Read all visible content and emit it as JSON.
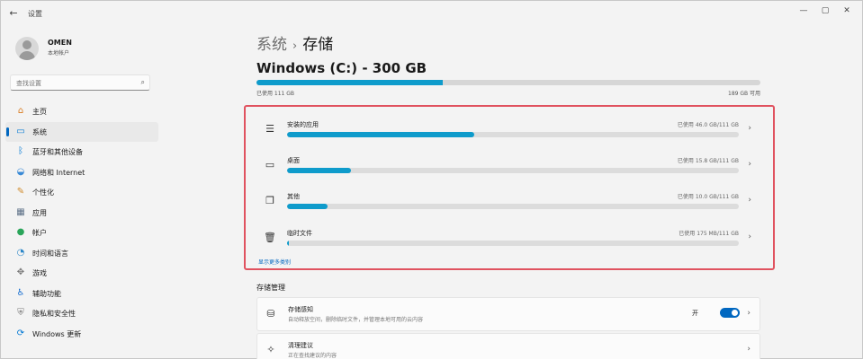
{
  "window": {
    "back_glyph": "←",
    "title": "设置",
    "minimize_glyph": "—",
    "maximize_glyph": "▢",
    "close_glyph": "✕"
  },
  "user": {
    "name": "OMEN",
    "account_type": "本地帐户"
  },
  "search": {
    "placeholder": "查找设置",
    "icon": "search-icon",
    "glyph": "⌕"
  },
  "nav": [
    {
      "label": "主页",
      "icon": "home-icon",
      "glyph": "⌂",
      "color": "#d97a1e",
      "active": false
    },
    {
      "label": "系统",
      "icon": "system-icon",
      "glyph": "▭",
      "color": "#0078d4",
      "active": true
    },
    {
      "label": "蓝牙和其他设备",
      "icon": "bluetooth-icon",
      "glyph": "ᛒ",
      "color": "#0078d4",
      "active": false
    },
    {
      "label": "网络和 Internet",
      "icon": "wifi-icon",
      "glyph": "◒",
      "color": "#3a8ad6",
      "active": false
    },
    {
      "label": "个性化",
      "icon": "brush-icon",
      "glyph": "✎",
      "color": "#d08a2a",
      "active": false
    },
    {
      "label": "应用",
      "icon": "apps-icon",
      "glyph": "▦",
      "color": "#5b6f86",
      "active": false
    },
    {
      "label": "帐户",
      "icon": "account-icon",
      "glyph": "●",
      "color": "#2aa55a",
      "active": false
    },
    {
      "label": "时间和语言",
      "icon": "globe-clock-icon",
      "glyph": "◔",
      "color": "#2a86c8",
      "active": false
    },
    {
      "label": "游戏",
      "icon": "gamepad-icon",
      "glyph": "✥",
      "color": "#777777",
      "active": false
    },
    {
      "label": "辅助功能",
      "icon": "accessibility-icon",
      "glyph": "♿",
      "color": "#1a6fd0",
      "active": false
    },
    {
      "label": "隐私和安全性",
      "icon": "shield-icon",
      "glyph": "⛨",
      "color": "#777777",
      "active": false
    },
    {
      "label": "Windows 更新",
      "icon": "windows-update-icon",
      "glyph": "⟳",
      "color": "#0078d4",
      "active": false
    }
  ],
  "page": {
    "breadcrumb_parent": "系统",
    "breadcrumb_separator": "›",
    "breadcrumb_current": "存储",
    "drive_title": "Windows (C:) - 300 GB",
    "used_label": "已使用 111 GB",
    "available_label": "189 GB 可用",
    "used_fraction": 0.37
  },
  "categories": [
    {
      "name": "安装的应用",
      "size": "已使用 46.0 GB/111 GB",
      "fraction": 0.414,
      "icon": "apps-list-icon",
      "glyph": "☰"
    },
    {
      "name": "桌面",
      "size": "已使用 15.8 GB/111 GB",
      "fraction": 0.142,
      "icon": "desktop-icon",
      "glyph": "▭"
    },
    {
      "name": "其他",
      "size": "已使用 10.0 GB/111 GB",
      "fraction": 0.09,
      "icon": "other-files-icon",
      "glyph": "❐"
    },
    {
      "name": "临时文件",
      "size": "已使用 175 MB/111 GB",
      "fraction": 0.002,
      "icon": "trash-icon",
      "glyph": "🗑"
    }
  ],
  "show_more": "显示更多类别",
  "chevron_glyph": "›",
  "management": {
    "section_title": "存储管理",
    "items": [
      {
        "title": "存储感知",
        "desc": "自动释放空间，删除临时文件，并管理本地可用的云内容",
        "icon": "database-icon",
        "glyph": "⛁",
        "toggle_label": "开",
        "toggle_on": true
      },
      {
        "title": "清理建议",
        "desc": "正在查找建议的内容",
        "icon": "broom-icon",
        "glyph": "✧"
      }
    ]
  },
  "colors": {
    "accent": "#0067c0",
    "bar_fill": "#0e9bcb",
    "highlight_border": "#e0525f"
  }
}
